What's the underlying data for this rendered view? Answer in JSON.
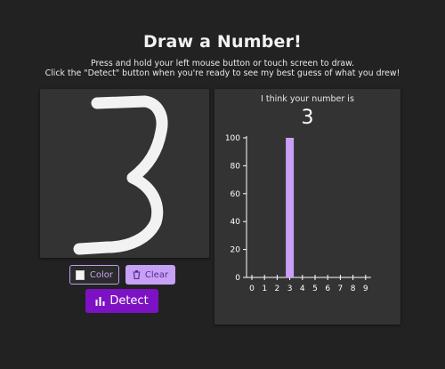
{
  "header": {
    "title": "Draw a Number!",
    "instructions_line1": "Press and hold your left mouse button or touch screen to draw.",
    "instructions_line2": "Click the \"Detect\" button when you're ready to see my best guess of what you drew!"
  },
  "canvas": {
    "background": "#333333",
    "stroke_color": "#f2f2f2"
  },
  "buttons": {
    "color_label": "Color",
    "clear_label": "Clear",
    "detect_label": "Detect",
    "clear_icon": "trash-icon",
    "detect_icon": "bar-chart-icon",
    "accent": "#7d12c4"
  },
  "result": {
    "caption": "I think your number is",
    "guess": "3"
  },
  "chart_data": {
    "type": "bar",
    "categories": [
      "0",
      "1",
      "2",
      "3",
      "4",
      "5",
      "6",
      "7",
      "8",
      "9"
    ],
    "values": [
      0,
      0,
      0,
      100,
      0,
      0,
      0,
      0,
      0,
      0
    ],
    "yticks": [
      0,
      20,
      40,
      60,
      80,
      100
    ],
    "ylim": [
      0,
      100
    ],
    "bar_color": "#c9a0f7",
    "axis_color": "#ffffff",
    "grid": false
  }
}
